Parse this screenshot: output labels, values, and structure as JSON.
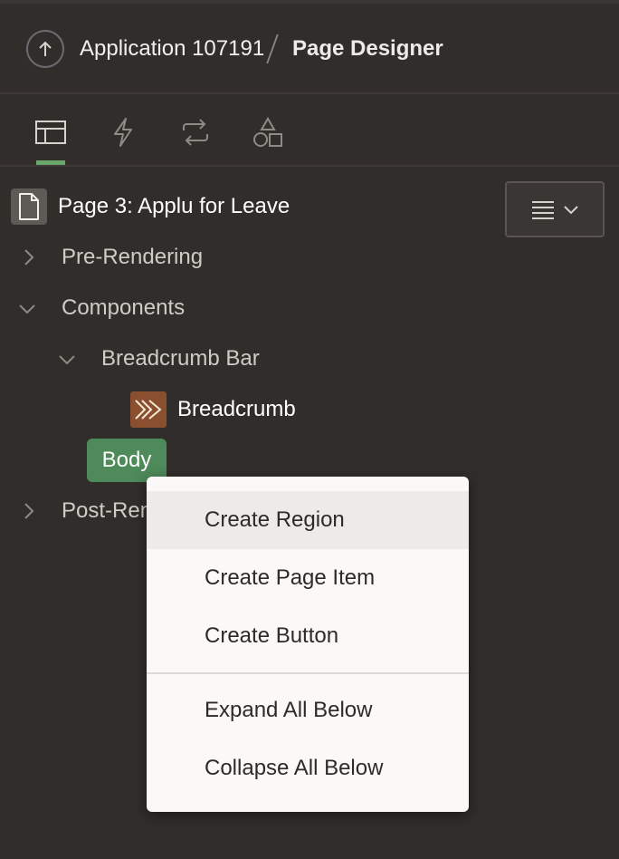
{
  "header": {
    "up_icon": "arrow-up-icon",
    "app_label": "Application 107191",
    "page_designer_label": "Page Designer"
  },
  "tabs": [
    {
      "icon": "layout-icon",
      "active": true
    },
    {
      "icon": "lightning-icon",
      "active": false
    },
    {
      "icon": "refresh-icon",
      "active": false
    },
    {
      "icon": "shapes-icon",
      "active": false
    }
  ],
  "tree": {
    "page_title": "Page 3: Applu for Leave",
    "pre_rendering": "Pre-Rendering",
    "components": "Components",
    "breadcrumb_bar": "Breadcrumb Bar",
    "breadcrumb": "Breadcrumb",
    "body": "Body",
    "post_rendering": "Post-Rendering"
  },
  "context_menu": {
    "items": [
      "Create Region",
      "Create Page Item",
      "Create Button",
      "Expand All Below",
      "Collapse All Below"
    ],
    "highlighted": "Create Region"
  },
  "colors": {
    "background": "#312d2a",
    "accent_green": "#4e8a5a",
    "breadcrumb_icon": "#8a4f2e"
  }
}
